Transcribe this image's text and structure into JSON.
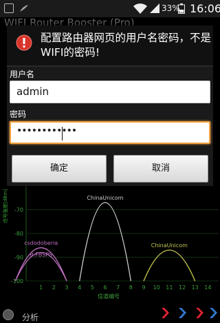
{
  "status_bar": {
    "battery_percent": "33%",
    "time": "16:06"
  },
  "app": {
    "title": "WIFI Router Booster (Pro)"
  },
  "dialog": {
    "title": "配置路由器网页的用户名密码，不是WIFI的密码!",
    "username_label": "用户名",
    "username_value": "admin",
    "password_label": "密码",
    "password_value": "••••••••••••",
    "ok_label": "确定",
    "cancel_label": "取消"
  },
  "chart_data": {
    "type": "area",
    "ylabel": "信号强度[dBm]",
    "xlabel": "信道编号",
    "ylim": [
      -100,
      -60
    ],
    "xlim": [
      0,
      15
    ],
    "yticks": [
      "-70",
      "-80",
      "-90",
      "-100"
    ],
    "xticks": [
      "1",
      "2",
      "3",
      "4",
      "5",
      "6",
      "7",
      "8",
      "9",
      "10",
      "11",
      "12",
      "13",
      "14"
    ],
    "series": [
      {
        "name": "csdodoberia",
        "channel": 1,
        "peak_dbm": -86,
        "color": "#c070c0"
      },
      {
        "name": "B.FBSPS",
        "channel": 1,
        "peak_dbm": -88,
        "color": "#c070c0"
      },
      {
        "name": "ChinaUnicom",
        "channel": 6,
        "peak_dbm": -67,
        "color": "#cccccc"
      },
      {
        "name": "ChinaUnicom",
        "channel": 11,
        "peak_dbm": -87,
        "color": "#c8c850"
      }
    ]
  },
  "bottom_bar": {
    "analyze_label": "分析"
  }
}
